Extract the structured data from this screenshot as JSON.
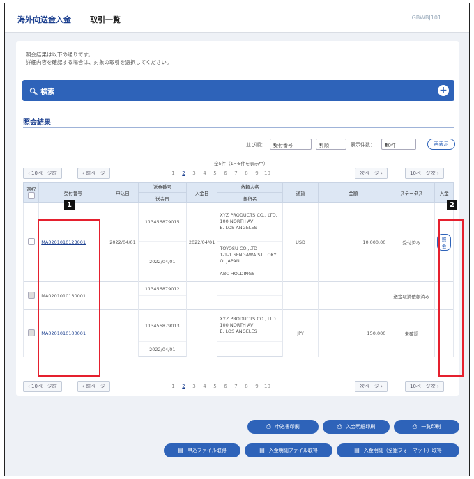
{
  "header": {
    "app_title": "海外向送金入金",
    "page_title": "取引一覧",
    "screen_id": "GBWBJ101"
  },
  "instructions": [
    "照会結果は以下の通りです。",
    "詳細内容を確認する場合は、対象の取引を選択してください。"
  ],
  "search": {
    "label": "検索"
  },
  "section": {
    "title": "照会結果"
  },
  "controls": {
    "sort_label": "並び順：",
    "sort_field": "受付番号",
    "sort_order": "昇順",
    "count_label": "表示件数：",
    "count_value": "30件",
    "show_button": "再表示"
  },
  "count_info": "全5件（1～5件を表示中）",
  "pager": {
    "prev10": "10ページ前",
    "prev": "前ページ",
    "next": "次ページ",
    "next10": "10ページ次",
    "pages": [
      "1",
      "2",
      "3",
      "4",
      "5",
      "6",
      "7",
      "8",
      "9",
      "10"
    ],
    "current": "2"
  },
  "table": {
    "headers": {
      "select": "選択",
      "ref_no": "受付番号",
      "date": "申込日",
      "remit_no": "送金番号",
      "remit_date": "送金日",
      "arrival_date": "入金日",
      "payer_name": "依頼人名",
      "bank_name": "銀行名",
      "currency": "通貨",
      "amount": "金額",
      "status": "ステータス",
      "notice": "入金"
    },
    "rows": [
      {
        "ref_no": "MA0201010123001",
        "date": "2022/04/01",
        "remit_no": "113456879015",
        "remit_date": "2022/04/01",
        "arrival_date": "2022/04/01",
        "payer_lines": [
          "XYZ PRODUCTS CO., LTD.",
          "100 NORTH AV",
          "E. LOS ANGELES"
        ],
        "bank_lines": [
          "TOYOSU CO.,LTD",
          "1-1-1 SENGAWA ST TOKY",
          "O, JAPAN",
          "",
          "ABC HOLDINGS"
        ],
        "currency": "USD",
        "amount": "10,000.00",
        "status": "受付済み",
        "notice": "照会"
      },
      {
        "ref_no": "MA0201010130001",
        "date": "",
        "remit_no": "113456879012",
        "remit_date": "",
        "arrival_date": "",
        "payer_lines": [],
        "bank_lines": [],
        "currency": "",
        "amount": "",
        "status": "送金取消依頼済み",
        "notice": ""
      },
      {
        "ref_no": "MA0201010100001",
        "date": "",
        "remit_no": "113456879013",
        "remit_date": "2022/04/01",
        "arrival_date": "",
        "payer_lines": [
          "XYZ PRODUCTS CO., LTD.",
          "100 NORTH AV",
          "E. LOS ANGELES"
        ],
        "bank_lines": [],
        "currency": "JPY",
        "amount": "150,000",
        "status": "未確認",
        "notice": ""
      }
    ]
  },
  "actions": {
    "print_list": "申込書印刷",
    "print_detail": "入金明細印刷",
    "print_all": "一覧印刷",
    "file_output": "申込ファイル取得",
    "detail_file": "入金明細ファイル取得",
    "detail_file_fmt": "入金明細（全銀フォーマット）取得"
  },
  "annotations": {
    "badge1": "1",
    "badge2": "2"
  }
}
